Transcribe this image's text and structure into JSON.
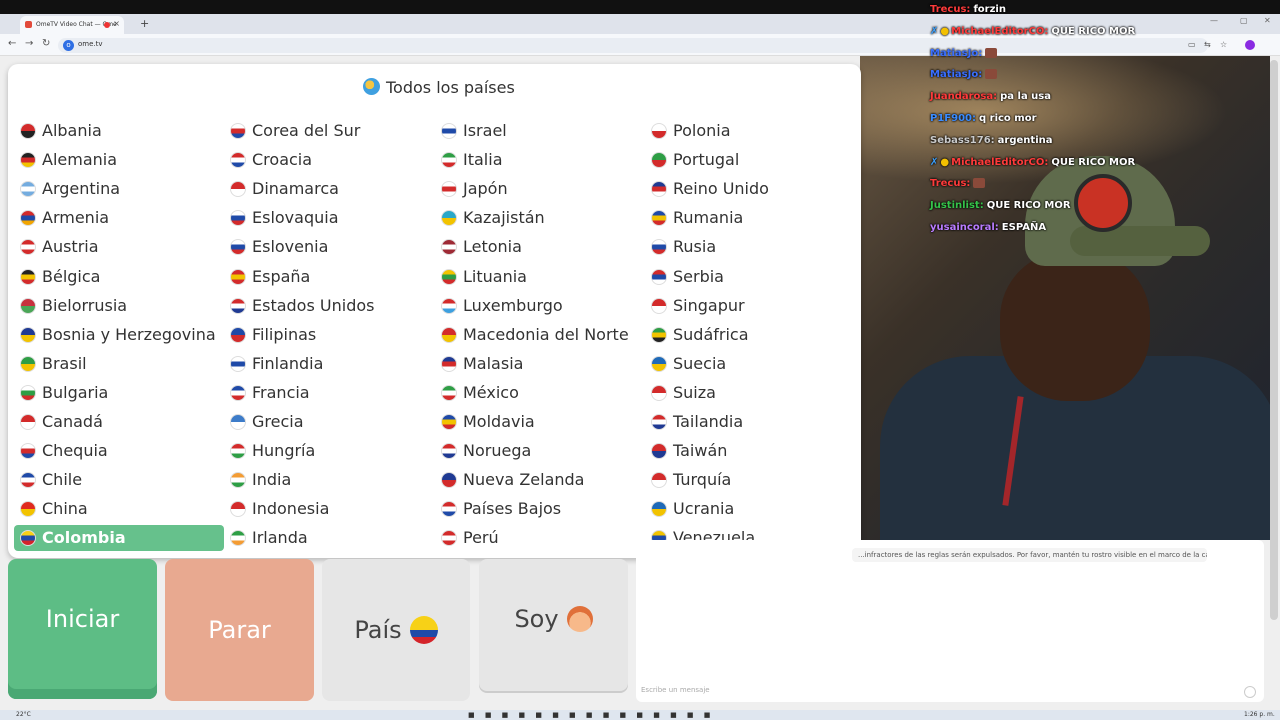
{
  "browser": {
    "tab_title": "OmeTV Video Chat — Ome",
    "url": "ome.tv",
    "new_tab": "+",
    "tab_close": "×",
    "back": "←",
    "forward": "→",
    "reload": "↻"
  },
  "panel": {
    "title": "Todos los países",
    "columns": [
      [
        {
          "name": "Albania",
          "colors": [
            "#d32b2b",
            "#222"
          ]
        },
        {
          "name": "Alemania",
          "colors": [
            "#222",
            "#d32b2b",
            "#f2c300"
          ]
        },
        {
          "name": "Argentina",
          "colors": [
            "#74acdf",
            "#fff",
            "#74acdf"
          ]
        },
        {
          "name": "Armenia",
          "colors": [
            "#d32b2b",
            "#1f4aa8",
            "#f2a500"
          ]
        },
        {
          "name": "Austria",
          "colors": [
            "#d32b2b",
            "#fff",
            "#d32b2b"
          ]
        },
        {
          "name": "Bélgica",
          "colors": [
            "#222",
            "#f2c300",
            "#d32b2b"
          ]
        },
        {
          "name": "Bielorrusia",
          "colors": [
            "#c8313e",
            "#4aa657"
          ]
        },
        {
          "name": "Bosnia y Herzegovina",
          "colors": [
            "#1f3a93",
            "#f2c300"
          ]
        },
        {
          "name": "Brasil",
          "colors": [
            "#2e9e45",
            "#f2c300"
          ]
        },
        {
          "name": "Bulgaria",
          "colors": [
            "#fff",
            "#2e9e45",
            "#d32b2b"
          ]
        },
        {
          "name": "Canadá",
          "colors": [
            "#d32b2b",
            "#fff"
          ]
        },
        {
          "name": "Chequia",
          "colors": [
            "#fff",
            "#d32b2b",
            "#1f4aa8"
          ]
        },
        {
          "name": "Chile",
          "colors": [
            "#1f4aa8",
            "#fff",
            "#d32b2b"
          ]
        },
        {
          "name": "China",
          "colors": [
            "#e02a1f",
            "#f2c300"
          ]
        },
        {
          "name": "Colombia",
          "colors": [
            "#f7d117",
            "#1f4aa8",
            "#d4242a"
          ],
          "selected": true
        }
      ],
      [
        {
          "name": "Corea del Sur",
          "colors": [
            "#fff",
            "#d32b2b",
            "#1f4aa8"
          ]
        },
        {
          "name": "Croacia",
          "colors": [
            "#d32b2b",
            "#fff",
            "#1f4aa8"
          ]
        },
        {
          "name": "Dinamarca",
          "colors": [
            "#d32b2b",
            "#fff"
          ]
        },
        {
          "name": "Eslovaquia",
          "colors": [
            "#fff",
            "#1f4aa8",
            "#d32b2b"
          ]
        },
        {
          "name": "Eslovenia",
          "colors": [
            "#fff",
            "#1f4aa8",
            "#d32b2b"
          ]
        },
        {
          "name": "España",
          "colors": [
            "#d32b2b",
            "#f2c300",
            "#d32b2b"
          ]
        },
        {
          "name": "Estados Unidos",
          "colors": [
            "#d32b2b",
            "#fff",
            "#1f3a93"
          ]
        },
        {
          "name": "Filipinas",
          "colors": [
            "#1f4aa8",
            "#d32b2b"
          ]
        },
        {
          "name": "Finlandia",
          "colors": [
            "#fff",
            "#1f4aa8",
            "#fff"
          ]
        },
        {
          "name": "Francia",
          "colors": [
            "#1f4aa8",
            "#fff",
            "#d32b2b"
          ]
        },
        {
          "name": "Grecia",
          "colors": [
            "#3d7cc9",
            "#fff"
          ]
        },
        {
          "name": "Hungría",
          "colors": [
            "#d32b2b",
            "#fff",
            "#2e9e45"
          ]
        },
        {
          "name": "India",
          "colors": [
            "#f39c34",
            "#fff",
            "#2e9e45"
          ]
        },
        {
          "name": "Indonesia",
          "colors": [
            "#d32b2b",
            "#fff"
          ]
        },
        {
          "name": "Irlanda",
          "colors": [
            "#2e9e45",
            "#fff",
            "#f39c34"
          ]
        }
      ],
      [
        {
          "name": "Israel",
          "colors": [
            "#fff",
            "#1f4aa8",
            "#fff"
          ]
        },
        {
          "name": "Italia",
          "colors": [
            "#2e9e45",
            "#fff",
            "#d32b2b"
          ]
        },
        {
          "name": "Japón",
          "colors": [
            "#fff",
            "#d32b2b",
            "#fff"
          ]
        },
        {
          "name": "Kazajistán",
          "colors": [
            "#2aa8c9",
            "#f2c300"
          ]
        },
        {
          "name": "Letonia",
          "colors": [
            "#9e2a35",
            "#fff",
            "#9e2a35"
          ]
        },
        {
          "name": "Lituania",
          "colors": [
            "#f2c300",
            "#2e9e45",
            "#d32b2b"
          ]
        },
        {
          "name": "Luxemburgo",
          "colors": [
            "#d32b2b",
            "#fff",
            "#3da0e0"
          ]
        },
        {
          "name": "Macedonia del Norte",
          "colors": [
            "#d32b2b",
            "#f2c300"
          ]
        },
        {
          "name": "Malasia",
          "colors": [
            "#1f3a93",
            "#d32b2b",
            "#fff"
          ]
        },
        {
          "name": "México",
          "colors": [
            "#2e9e45",
            "#fff",
            "#d32b2b"
          ]
        },
        {
          "name": "Moldavia",
          "colors": [
            "#1f4aa8",
            "#f2c300",
            "#d32b2b"
          ]
        },
        {
          "name": "Noruega",
          "colors": [
            "#d32b2b",
            "#fff",
            "#1f3a93"
          ]
        },
        {
          "name": "Nueva Zelanda",
          "colors": [
            "#1f3a93",
            "#d32b2b"
          ]
        },
        {
          "name": "Países Bajos",
          "colors": [
            "#d32b2b",
            "#fff",
            "#1f4aa8"
          ]
        },
        {
          "name": "Perú",
          "colors": [
            "#d32b2b",
            "#fff",
            "#d32b2b"
          ]
        }
      ],
      [
        {
          "name": "Polonia",
          "colors": [
            "#fff",
            "#d32b2b"
          ]
        },
        {
          "name": "Portugal",
          "colors": [
            "#2e9e45",
            "#d32b2b"
          ]
        },
        {
          "name": "Reino Unido",
          "colors": [
            "#1f3a93",
            "#d32b2b",
            "#fff"
          ]
        },
        {
          "name": "Rumania",
          "colors": [
            "#1f4aa8",
            "#f2c300",
            "#d32b2b"
          ]
        },
        {
          "name": "Rusia",
          "colors": [
            "#fff",
            "#1f4aa8",
            "#d32b2b"
          ]
        },
        {
          "name": "Serbia",
          "colors": [
            "#d32b2b",
            "#1f4aa8",
            "#fff"
          ]
        },
        {
          "name": "Singapur",
          "colors": [
            "#d32b2b",
            "#fff"
          ]
        },
        {
          "name": "Sudáfrica",
          "colors": [
            "#2e9e45",
            "#f2c300",
            "#222"
          ]
        },
        {
          "name": "Suecia",
          "colors": [
            "#1f6ab8",
            "#f2c300"
          ]
        },
        {
          "name": "Suiza",
          "colors": [
            "#d32b2b",
            "#fff"
          ]
        },
        {
          "name": "Tailandia",
          "colors": [
            "#d32b2b",
            "#fff",
            "#1f3a93"
          ]
        },
        {
          "name": "Taiwán",
          "colors": [
            "#d32b2b",
            "#1f3a93"
          ]
        },
        {
          "name": "Turquía",
          "colors": [
            "#d32b2b",
            "#fff"
          ]
        },
        {
          "name": "Ucrania",
          "colors": [
            "#1f6ab8",
            "#f2c300"
          ]
        },
        {
          "name": "Venezuela",
          "colors": [
            "#f2c300",
            "#1f4aa8",
            "#d32b2b"
          ]
        }
      ]
    ]
  },
  "controls": {
    "start_label": "Iniciar",
    "stop_label": "Parar",
    "country_label": "País",
    "me_label": "Soy"
  },
  "chat": {
    "rules_text": "...infractores de las reglas serán expulsados. Por favor, mantén tu rostro visible en el marco de la cámara.",
    "input_placeholder": "Escribe un mensaje"
  },
  "stream_chat": [
    {
      "user": "Trecus:",
      "color": "#ff3b3b",
      "text": "forzin"
    },
    {
      "user": "MichaelEditorCO:",
      "color": "#ff3b3b",
      "text": "QUE RICO MOR",
      "badges": true
    },
    {
      "user": "MatiasJo:",
      "color": "#3a6fff",
      "text": "",
      "emote": true
    },
    {
      "user": "MatiasJo:",
      "color": "#3a6fff",
      "text": "",
      "emote": true
    },
    {
      "user": "Juandarosa:",
      "color": "#ff3b3b",
      "text": "pa la usa"
    },
    {
      "user": "P1F900:",
      "color": "#3a8cff",
      "text": "q rico mor"
    },
    {
      "user": "Sebass176:",
      "color": "#cccccc",
      "text": "argentina"
    },
    {
      "user": "MichaelEditorCO:",
      "color": "#ff3b3b",
      "text": "QUE RICO MOR",
      "badges": true
    },
    {
      "user": "Trecus:",
      "color": "#ff3b3b",
      "text": "",
      "emote": true
    },
    {
      "user": "Justinlist:",
      "color": "#35c24a",
      "text": "QUE RICO MOR"
    },
    {
      "user": "yusaincoral:",
      "color": "#b97cff",
      "text": "ESPAÑA"
    }
  ],
  "taskbar": {
    "weather": "22°C",
    "clock": "1:26 p. m."
  }
}
